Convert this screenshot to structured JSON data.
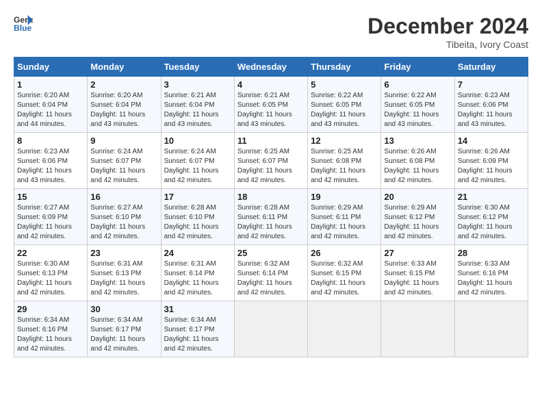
{
  "logo": {
    "line1": "General",
    "line2": "Blue"
  },
  "title": {
    "month_year": "December 2024",
    "location": "Tibeita, Ivory Coast"
  },
  "calendar": {
    "headers": [
      "Sunday",
      "Monday",
      "Tuesday",
      "Wednesday",
      "Thursday",
      "Friday",
      "Saturday"
    ],
    "weeks": [
      [
        {
          "day": "",
          "info": ""
        },
        {
          "day": "2",
          "info": "Sunrise: 6:20 AM\nSunset: 6:04 PM\nDaylight: 11 hours\nand 43 minutes."
        },
        {
          "day": "3",
          "info": "Sunrise: 6:21 AM\nSunset: 6:04 PM\nDaylight: 11 hours\nand 43 minutes."
        },
        {
          "day": "4",
          "info": "Sunrise: 6:21 AM\nSunset: 6:05 PM\nDaylight: 11 hours\nand 43 minutes."
        },
        {
          "day": "5",
          "info": "Sunrise: 6:22 AM\nSunset: 6:05 PM\nDaylight: 11 hours\nand 43 minutes."
        },
        {
          "day": "6",
          "info": "Sunrise: 6:22 AM\nSunset: 6:05 PM\nDaylight: 11 hours\nand 43 minutes."
        },
        {
          "day": "7",
          "info": "Sunrise: 6:23 AM\nSunset: 6:06 PM\nDaylight: 11 hours\nand 43 minutes."
        }
      ],
      [
        {
          "day": "1",
          "info": "Sunrise: 6:20 AM\nSunset: 6:04 PM\nDaylight: 11 hours\nand 44 minutes."
        },
        {
          "day": "",
          "info": ""
        },
        {
          "day": "",
          "info": ""
        },
        {
          "day": "",
          "info": ""
        },
        {
          "day": "",
          "info": ""
        },
        {
          "day": "",
          "info": ""
        },
        {
          "day": "",
          "info": ""
        }
      ],
      [
        {
          "day": "8",
          "info": "Sunrise: 6:23 AM\nSunset: 6:06 PM\nDaylight: 11 hours\nand 43 minutes."
        },
        {
          "day": "9",
          "info": "Sunrise: 6:24 AM\nSunset: 6:07 PM\nDaylight: 11 hours\nand 42 minutes."
        },
        {
          "day": "10",
          "info": "Sunrise: 6:24 AM\nSunset: 6:07 PM\nDaylight: 11 hours\nand 42 minutes."
        },
        {
          "day": "11",
          "info": "Sunrise: 6:25 AM\nSunset: 6:07 PM\nDaylight: 11 hours\nand 42 minutes."
        },
        {
          "day": "12",
          "info": "Sunrise: 6:25 AM\nSunset: 6:08 PM\nDaylight: 11 hours\nand 42 minutes."
        },
        {
          "day": "13",
          "info": "Sunrise: 6:26 AM\nSunset: 6:08 PM\nDaylight: 11 hours\nand 42 minutes."
        },
        {
          "day": "14",
          "info": "Sunrise: 6:26 AM\nSunset: 6:09 PM\nDaylight: 11 hours\nand 42 minutes."
        }
      ],
      [
        {
          "day": "15",
          "info": "Sunrise: 6:27 AM\nSunset: 6:09 PM\nDaylight: 11 hours\nand 42 minutes."
        },
        {
          "day": "16",
          "info": "Sunrise: 6:27 AM\nSunset: 6:10 PM\nDaylight: 11 hours\nand 42 minutes."
        },
        {
          "day": "17",
          "info": "Sunrise: 6:28 AM\nSunset: 6:10 PM\nDaylight: 11 hours\nand 42 minutes."
        },
        {
          "day": "18",
          "info": "Sunrise: 6:28 AM\nSunset: 6:11 PM\nDaylight: 11 hours\nand 42 minutes."
        },
        {
          "day": "19",
          "info": "Sunrise: 6:29 AM\nSunset: 6:11 PM\nDaylight: 11 hours\nand 42 minutes."
        },
        {
          "day": "20",
          "info": "Sunrise: 6:29 AM\nSunset: 6:12 PM\nDaylight: 11 hours\nand 42 minutes."
        },
        {
          "day": "21",
          "info": "Sunrise: 6:30 AM\nSunset: 6:12 PM\nDaylight: 11 hours\nand 42 minutes."
        }
      ],
      [
        {
          "day": "22",
          "info": "Sunrise: 6:30 AM\nSunset: 6:13 PM\nDaylight: 11 hours\nand 42 minutes."
        },
        {
          "day": "23",
          "info": "Sunrise: 6:31 AM\nSunset: 6:13 PM\nDaylight: 11 hours\nand 42 minutes."
        },
        {
          "day": "24",
          "info": "Sunrise: 6:31 AM\nSunset: 6:14 PM\nDaylight: 11 hours\nand 42 minutes."
        },
        {
          "day": "25",
          "info": "Sunrise: 6:32 AM\nSunset: 6:14 PM\nDaylight: 11 hours\nand 42 minutes."
        },
        {
          "day": "26",
          "info": "Sunrise: 6:32 AM\nSunset: 6:15 PM\nDaylight: 11 hours\nand 42 minutes."
        },
        {
          "day": "27",
          "info": "Sunrise: 6:33 AM\nSunset: 6:15 PM\nDaylight: 11 hours\nand 42 minutes."
        },
        {
          "day": "28",
          "info": "Sunrise: 6:33 AM\nSunset: 6:16 PM\nDaylight: 11 hours\nand 42 minutes."
        }
      ],
      [
        {
          "day": "29",
          "info": "Sunrise: 6:34 AM\nSunset: 6:16 PM\nDaylight: 11 hours\nand 42 minutes."
        },
        {
          "day": "30",
          "info": "Sunrise: 6:34 AM\nSunset: 6:17 PM\nDaylight: 11 hours\nand 42 minutes."
        },
        {
          "day": "31",
          "info": "Sunrise: 6:34 AM\nSunset: 6:17 PM\nDaylight: 11 hours\nand 42 minutes."
        },
        {
          "day": "",
          "info": ""
        },
        {
          "day": "",
          "info": ""
        },
        {
          "day": "",
          "info": ""
        },
        {
          "day": "",
          "info": ""
        }
      ]
    ]
  }
}
